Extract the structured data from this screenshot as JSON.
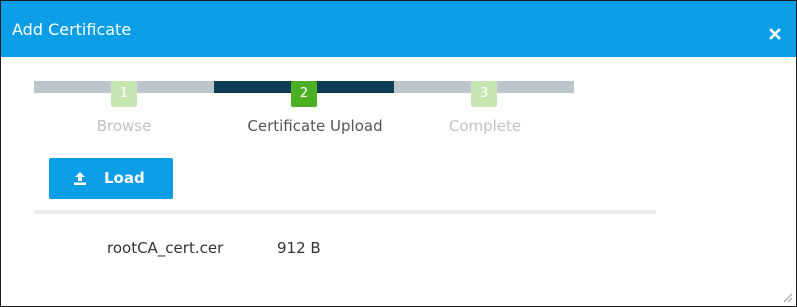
{
  "dialog": {
    "title": "Add Certificate",
    "close_icon": "close-icon"
  },
  "stepper": {
    "steps": [
      {
        "number": "1",
        "label": "Browse",
        "state": "completed"
      },
      {
        "number": "2",
        "label": "Certificate Upload",
        "state": "active"
      },
      {
        "number": "3",
        "label": "Complete",
        "state": "pending"
      }
    ]
  },
  "toolbar": {
    "load_label": "Load",
    "load_icon": "upload-icon"
  },
  "files": [
    {
      "name": "rootCA_cert.cer",
      "size": "912 B"
    }
  ],
  "colors": {
    "accent": "#0b9ee6",
    "step_active": "#4caf24",
    "step_inactive": "#c6e6b1",
    "track_active": "#0f3c55",
    "track_inactive": "#bcc6cc"
  }
}
